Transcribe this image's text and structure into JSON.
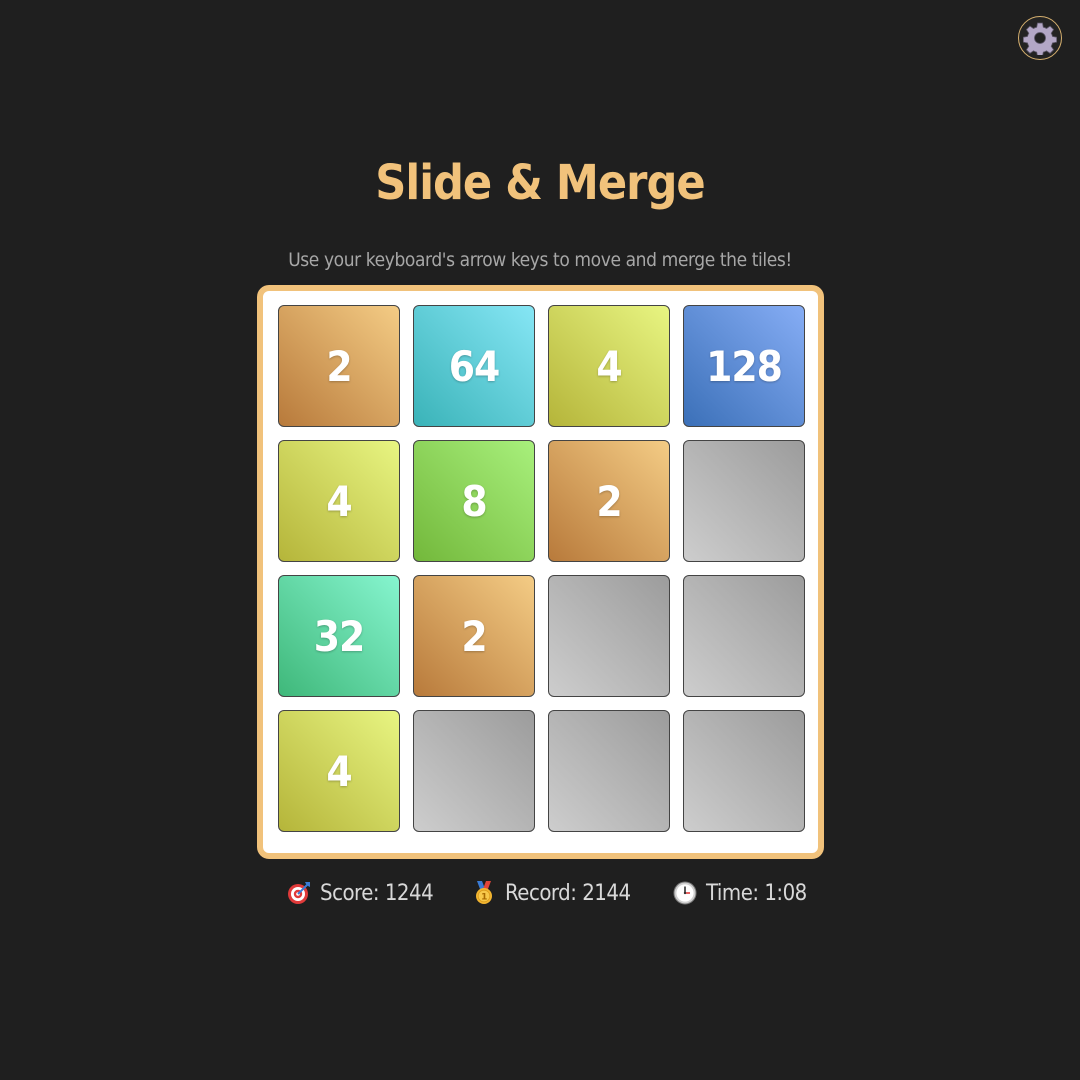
{
  "header": {
    "settings_icon": "gear-icon",
    "title": "Slide & Merge",
    "subtitle": "Use your keyboard's arrow keys to move and merge the tiles!"
  },
  "board": {
    "rows": [
      [
        "2",
        "64",
        "4",
        "128"
      ],
      [
        "4",
        "8",
        "2",
        ""
      ],
      [
        "32",
        "2",
        "",
        ""
      ],
      [
        "4",
        "",
        "",
        ""
      ]
    ]
  },
  "stats": {
    "score_icon": "target-icon",
    "score": "Score: 1244",
    "record_icon": "medal-icon",
    "record": "Record: 2144",
    "time_icon": "clock-icon",
    "time": "Time: 1:08"
  },
  "colors": {
    "background": "#1f1f1f",
    "accent": "#f1c27b",
    "tile_2": "#d9a05b",
    "tile_4": "#d2dc5e",
    "tile_8": "#8fd65b",
    "tile_32": "#5fd6a4",
    "tile_64": "#5fccd6",
    "tile_128": "#5f8fd6",
    "tile_empty": "#b5b5b5"
  }
}
